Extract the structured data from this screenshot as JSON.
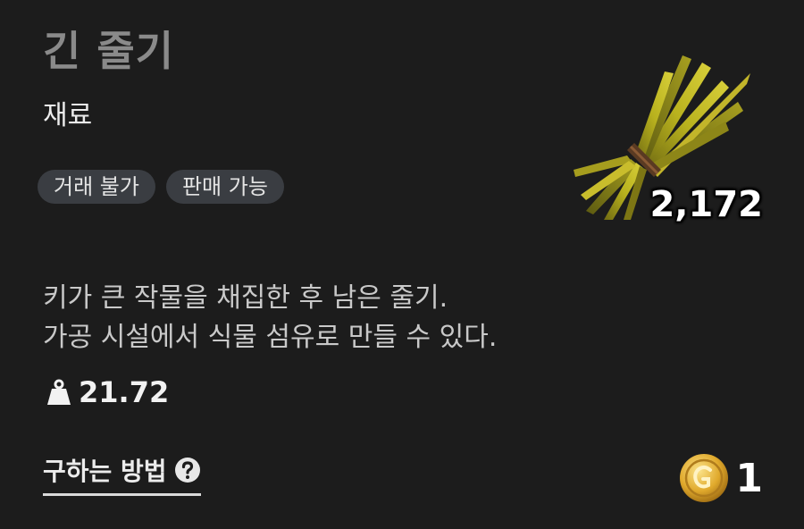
{
  "item": {
    "name": "긴 줄기",
    "category": "재료",
    "tags": [
      "거래 불가",
      "판매 가능"
    ],
    "quantity": "2,172",
    "description": [
      "키가 큰 작물을 채집한 후 남은 줄기.",
      "가공 시설에서 식물 섬유로 만들 수 있다."
    ],
    "weight": "21.72",
    "image_icon": "stalk-bundle-icon"
  },
  "footer": {
    "how_to_obtain_label": "구하는 방법",
    "help_icon": "question-mark-icon",
    "price": "1",
    "price_icon": "gold-coin-icon"
  },
  "colors": {
    "background": "#1c1c1c",
    "title": "#8a8a8a",
    "tag_bg": "#3a3d42",
    "coin": "#e0a92c"
  }
}
